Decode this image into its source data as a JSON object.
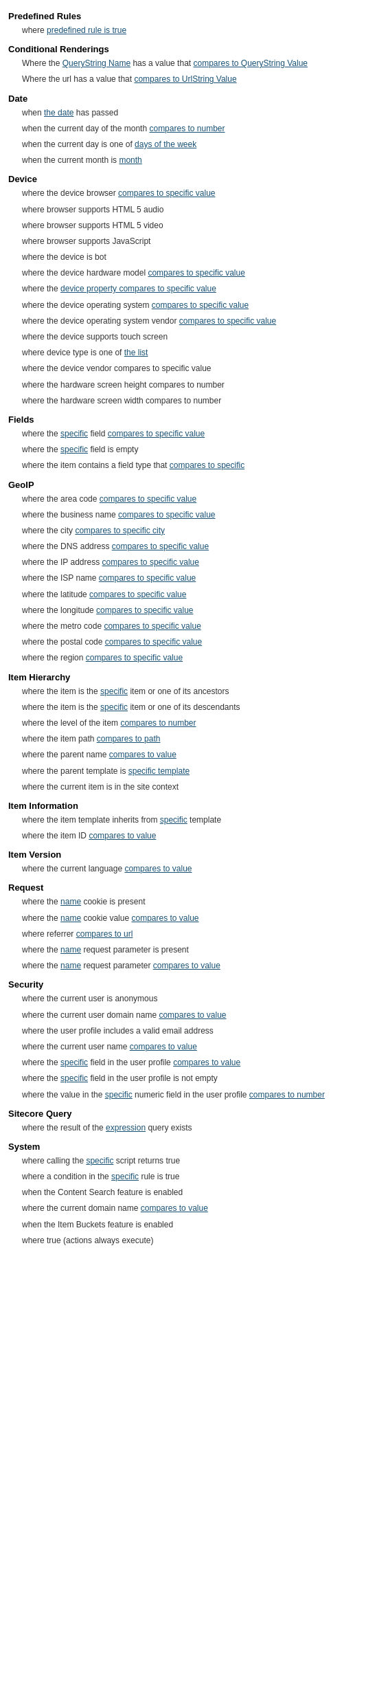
{
  "sections": [
    {
      "id": "predefined-rules",
      "title": "Predefined Rules",
      "items": [
        {
          "text": "where ",
          "links": [
            {
              "label": "predefined rule is true",
              "pos": 1
            }
          ],
          "parts": [
            "where ",
            "predefined rule is true"
          ]
        }
      ]
    },
    {
      "id": "conditional-renderings",
      "title": "Conditional Renderings",
      "items": [
        {
          "parts": [
            "Where the ",
            "QueryString Name",
            " has a value that ",
            "compares to QueryString Value"
          ]
        },
        {
          "parts": [
            "Where the url has a value that ",
            "compares to UrlString Value"
          ]
        }
      ]
    },
    {
      "id": "date",
      "title": "Date",
      "items": [
        {
          "parts": [
            "when ",
            "the date",
            " has passed"
          ]
        },
        {
          "parts": [
            "when the current day of the month ",
            "compares to number"
          ]
        },
        {
          "parts": [
            "when the current day is one of ",
            "days of the week"
          ]
        },
        {
          "parts": [
            "when the current month is ",
            "month"
          ]
        }
      ]
    },
    {
      "id": "device",
      "title": "Device",
      "items": [
        {
          "parts": [
            "where the device browser ",
            "compares to specific value"
          ]
        },
        {
          "parts": [
            "where browser supports HTML 5 audio"
          ]
        },
        {
          "parts": [
            "where browser supports HTML 5 video"
          ]
        },
        {
          "parts": [
            "where browser supports JavaScript"
          ]
        },
        {
          "parts": [
            "where the device is bot"
          ]
        },
        {
          "parts": [
            "where the device hardware model ",
            "compares to specific value"
          ]
        },
        {
          "parts": [
            "where the ",
            "device property compares to specific value"
          ]
        },
        {
          "parts": [
            "where the device operating system ",
            "compares to specific value"
          ]
        },
        {
          "parts": [
            "where the device operating system vendor ",
            "compares to specific value"
          ]
        },
        {
          "parts": [
            "where the device supports touch screen"
          ]
        },
        {
          "parts": [
            "where device type is one of ",
            "the list"
          ]
        },
        {
          "parts": [
            "where the device vendor ",
            "compares to specific value"
          ]
        },
        {
          "parts": [
            "where the hardware screen height ",
            "compares to number"
          ]
        },
        {
          "parts": [
            "where the hardware screen width ",
            "compares to number"
          ]
        }
      ]
    },
    {
      "id": "fields",
      "title": "Fields",
      "items": [
        {
          "parts": [
            "where the ",
            "specific",
            " field ",
            "compares to specific value"
          ]
        },
        {
          "parts": [
            "where the ",
            "specific",
            " field is empty"
          ]
        },
        {
          "parts": [
            "where the item contains a field type that ",
            "compares to specific"
          ]
        }
      ]
    },
    {
      "id": "geoip",
      "title": "GeoIP",
      "items": [
        {
          "parts": [
            "where the area code ",
            "compares to specific value"
          ]
        },
        {
          "parts": [
            "where the business name ",
            "compares to specific value"
          ]
        },
        {
          "parts": [
            "where the city ",
            "compares to specific city"
          ]
        },
        {
          "parts": [
            "where the DNS address ",
            "compares to specific value"
          ]
        },
        {
          "parts": [
            "where the IP address ",
            "compares to specific value"
          ]
        },
        {
          "parts": [
            "where the ISP name ",
            "compares to specific value"
          ]
        },
        {
          "parts": [
            "where the latitude ",
            "compares to specific value"
          ]
        },
        {
          "parts": [
            "where the longitude ",
            "compares to specific value"
          ]
        },
        {
          "parts": [
            "where the metro code ",
            "compares to specific value"
          ]
        },
        {
          "parts": [
            "where the postal code ",
            "compares to specific value"
          ]
        },
        {
          "parts": [
            "where the region ",
            "compares to specific value"
          ]
        }
      ]
    },
    {
      "id": "item-hierarchy",
      "title": "Item Hierarchy",
      "items": [
        {
          "parts": [
            "where the item is the ",
            "specific",
            " item or one of its ancestors"
          ]
        },
        {
          "parts": [
            "where the item is the ",
            "specific",
            " item or one of its descendants"
          ]
        },
        {
          "parts": [
            "where the level of the item ",
            "compares to number"
          ]
        },
        {
          "parts": [
            "where the item path ",
            "compares to path"
          ]
        },
        {
          "parts": [
            "where the parent name ",
            "compares to value"
          ]
        },
        {
          "parts": [
            "where the parent template is ",
            "specific template"
          ]
        },
        {
          "parts": [
            "where the current item is in the site context"
          ]
        }
      ]
    },
    {
      "id": "item-information",
      "title": "Item Information",
      "items": [
        {
          "parts": [
            "where the item template inherits from ",
            "specific",
            " template"
          ]
        },
        {
          "parts": [
            "where the item ID ",
            "compares to value"
          ]
        }
      ]
    },
    {
      "id": "item-version",
      "title": "Item Version",
      "items": [
        {
          "parts": [
            "where the current language ",
            "compares to value"
          ]
        }
      ]
    },
    {
      "id": "request",
      "title": "Request",
      "items": [
        {
          "parts": [
            "where the ",
            "name",
            " cookie is present"
          ]
        },
        {
          "parts": [
            "where the ",
            "name",
            " cookie value ",
            "compares to value"
          ]
        },
        {
          "parts": [
            "where referrer ",
            "compares to url"
          ]
        },
        {
          "parts": [
            "where the ",
            "name",
            " request parameter is present"
          ]
        },
        {
          "parts": [
            "where the ",
            "name",
            " request parameter ",
            "compares to value"
          ]
        }
      ]
    },
    {
      "id": "security",
      "title": "Security",
      "items": [
        {
          "parts": [
            "where the current user is anonymous"
          ]
        },
        {
          "parts": [
            "where the current user domain name ",
            "compares to value"
          ]
        },
        {
          "parts": [
            "where the user profile includes a valid email address"
          ]
        },
        {
          "parts": [
            "where the current user name ",
            "compares to value"
          ]
        },
        {
          "parts": [
            "where the ",
            "specific",
            " field in the user profile ",
            "compares to value"
          ]
        },
        {
          "parts": [
            "where the ",
            "specific",
            " field in the user profile is not empty"
          ]
        },
        {
          "parts": [
            "where the value in the ",
            "specific",
            " numeric field in the user profile ",
            "compares to number"
          ]
        }
      ]
    },
    {
      "id": "sitecore-query",
      "title": "Sitecore Query",
      "items": [
        {
          "parts": [
            "where the result of the ",
            "expression",
            " query exists"
          ]
        }
      ]
    },
    {
      "id": "system",
      "title": "System",
      "items": [
        {
          "parts": [
            "where calling the ",
            "specific",
            " script returns true"
          ]
        },
        {
          "parts": [
            "where a condition in the ",
            "specific",
            " rule is true"
          ]
        },
        {
          "parts": [
            "when the Content Search feature is enabled"
          ]
        },
        {
          "parts": [
            "where the current domain name ",
            "compares to value"
          ]
        },
        {
          "parts": [
            "when the Item Buckets feature is enabled"
          ]
        },
        {
          "parts": [
            "where true (actions always execute)"
          ]
        }
      ]
    }
  ],
  "linkIndices": {
    "predefined-rules": {
      "0": [
        1
      ]
    },
    "conditional-renderings": {
      "0": [
        1,
        3
      ],
      "1": [
        1
      ]
    },
    "date": {
      "0": [
        1
      ],
      "1": [
        1
      ],
      "2": [
        1
      ],
      "3": [
        1
      ]
    },
    "device": {
      "0": [
        1
      ],
      "3": [
        1
      ],
      "4": [
        1
      ],
      "5": [
        1
      ],
      "6": [
        1
      ],
      "7": [
        1
      ],
      "8": [
        1
      ],
      "9": [
        1
      ],
      "10": [
        1
      ]
    },
    "fields": {
      "0": [
        1,
        3
      ],
      "1": [
        1
      ],
      "2": [
        1
      ]
    },
    "geoip": {
      "0": [
        1
      ],
      "1": [
        1
      ],
      "2": [
        1
      ],
      "3": [
        1
      ],
      "4": [
        1
      ],
      "5": [
        1
      ],
      "6": [
        1
      ],
      "7": [
        1
      ],
      "8": [
        1
      ],
      "9": [
        1
      ],
      "10": [
        1
      ]
    },
    "item-hierarchy": {
      "0": [
        1
      ],
      "1": [
        1
      ],
      "2": [
        1
      ],
      "3": [
        1
      ],
      "4": [
        1
      ],
      "5": [
        1
      ]
    },
    "item-information": {
      "0": [
        1
      ],
      "1": [
        1
      ]
    },
    "item-version": {
      "0": [
        1
      ]
    },
    "request": {
      "0": [
        1
      ],
      "1": [
        1,
        3
      ],
      "2": [
        1
      ],
      "3": [
        1
      ],
      "4": [
        1,
        3
      ]
    },
    "security": {
      "1": [
        1
      ],
      "3": [
        1
      ],
      "4": [
        1,
        3
      ],
      "5": [
        1
      ],
      "6": [
        1,
        3,
        5
      ]
    },
    "sitecore-query": {
      "0": [
        1
      ]
    },
    "system": {
      "0": [
        1
      ],
      "1": [
        1
      ],
      "3": [
        1
      ]
    }
  }
}
